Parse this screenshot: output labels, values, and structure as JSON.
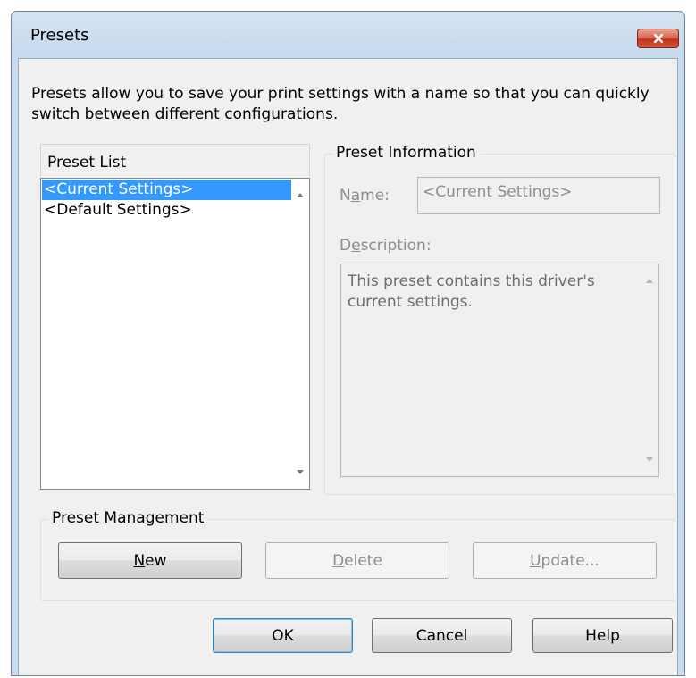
{
  "window": {
    "title": "Presets",
    "close_icon": "close-icon"
  },
  "intro_text": "Presets allow you to save your print settings with a name so that you can quickly switch between different configurations.",
  "preset_list": {
    "label": "Preset List",
    "items": [
      "<Current Settings>",
      "<Default Settings>"
    ],
    "selected_index": 0
  },
  "preset_information": {
    "legend": "Preset Information",
    "name_label_pre": "N",
    "name_label_u": "a",
    "name_label_post": "me:",
    "name_value": "<Current Settings>",
    "description_label_pre": "D",
    "description_label_u": "e",
    "description_label_post": "scription:",
    "description_value": "This preset contains this driver's current settings."
  },
  "preset_management": {
    "legend": "Preset Management",
    "new_u": "N",
    "new_rest": "ew",
    "delete_u": "D",
    "delete_rest": "elete",
    "update_u": "U",
    "update_rest": "pdate..."
  },
  "footer": {
    "ok_label": "OK",
    "cancel_label": "Cancel",
    "help_label": "Help"
  },
  "colors": {
    "selection": "#3399ff",
    "close_button": "#c1331b",
    "title_bar": "#c9dbee"
  }
}
